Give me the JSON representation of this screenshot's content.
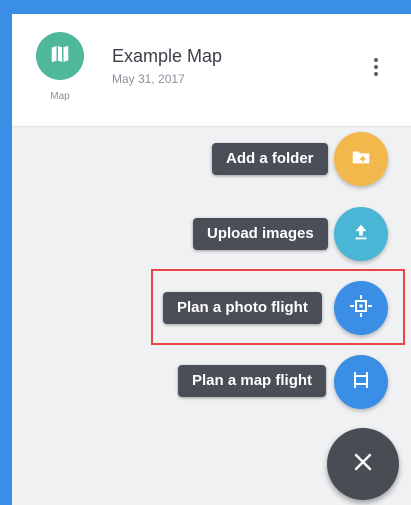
{
  "header": {
    "map_icon": "folded-map-icon",
    "map_icon_caption": "Map",
    "title": "Example Map",
    "date": "May 31, 2017",
    "menu_icon": "more-vertical-icon"
  },
  "actions": [
    {
      "label": "Add a folder",
      "icon": "add-folder-icon",
      "color": "#f2b84b"
    },
    {
      "label": "Upload images",
      "icon": "upload-icon",
      "color": "#4ab6d6"
    },
    {
      "label": "Plan a photo flight",
      "icon": "photo-flight-target-icon",
      "color": "#3a8ee6"
    },
    {
      "label": "Plan a map flight",
      "icon": "map-flight-route-icon",
      "color": "#3a8ee6"
    }
  ],
  "close_button": {
    "icon": "close-icon",
    "color": "#484d54"
  },
  "colors": {
    "frame": "#3a8ee6",
    "panel_bg": "#f0f1f3",
    "avatar": "#4fb89a",
    "label_bg": "#4a4f57",
    "highlight": "#e64646"
  }
}
